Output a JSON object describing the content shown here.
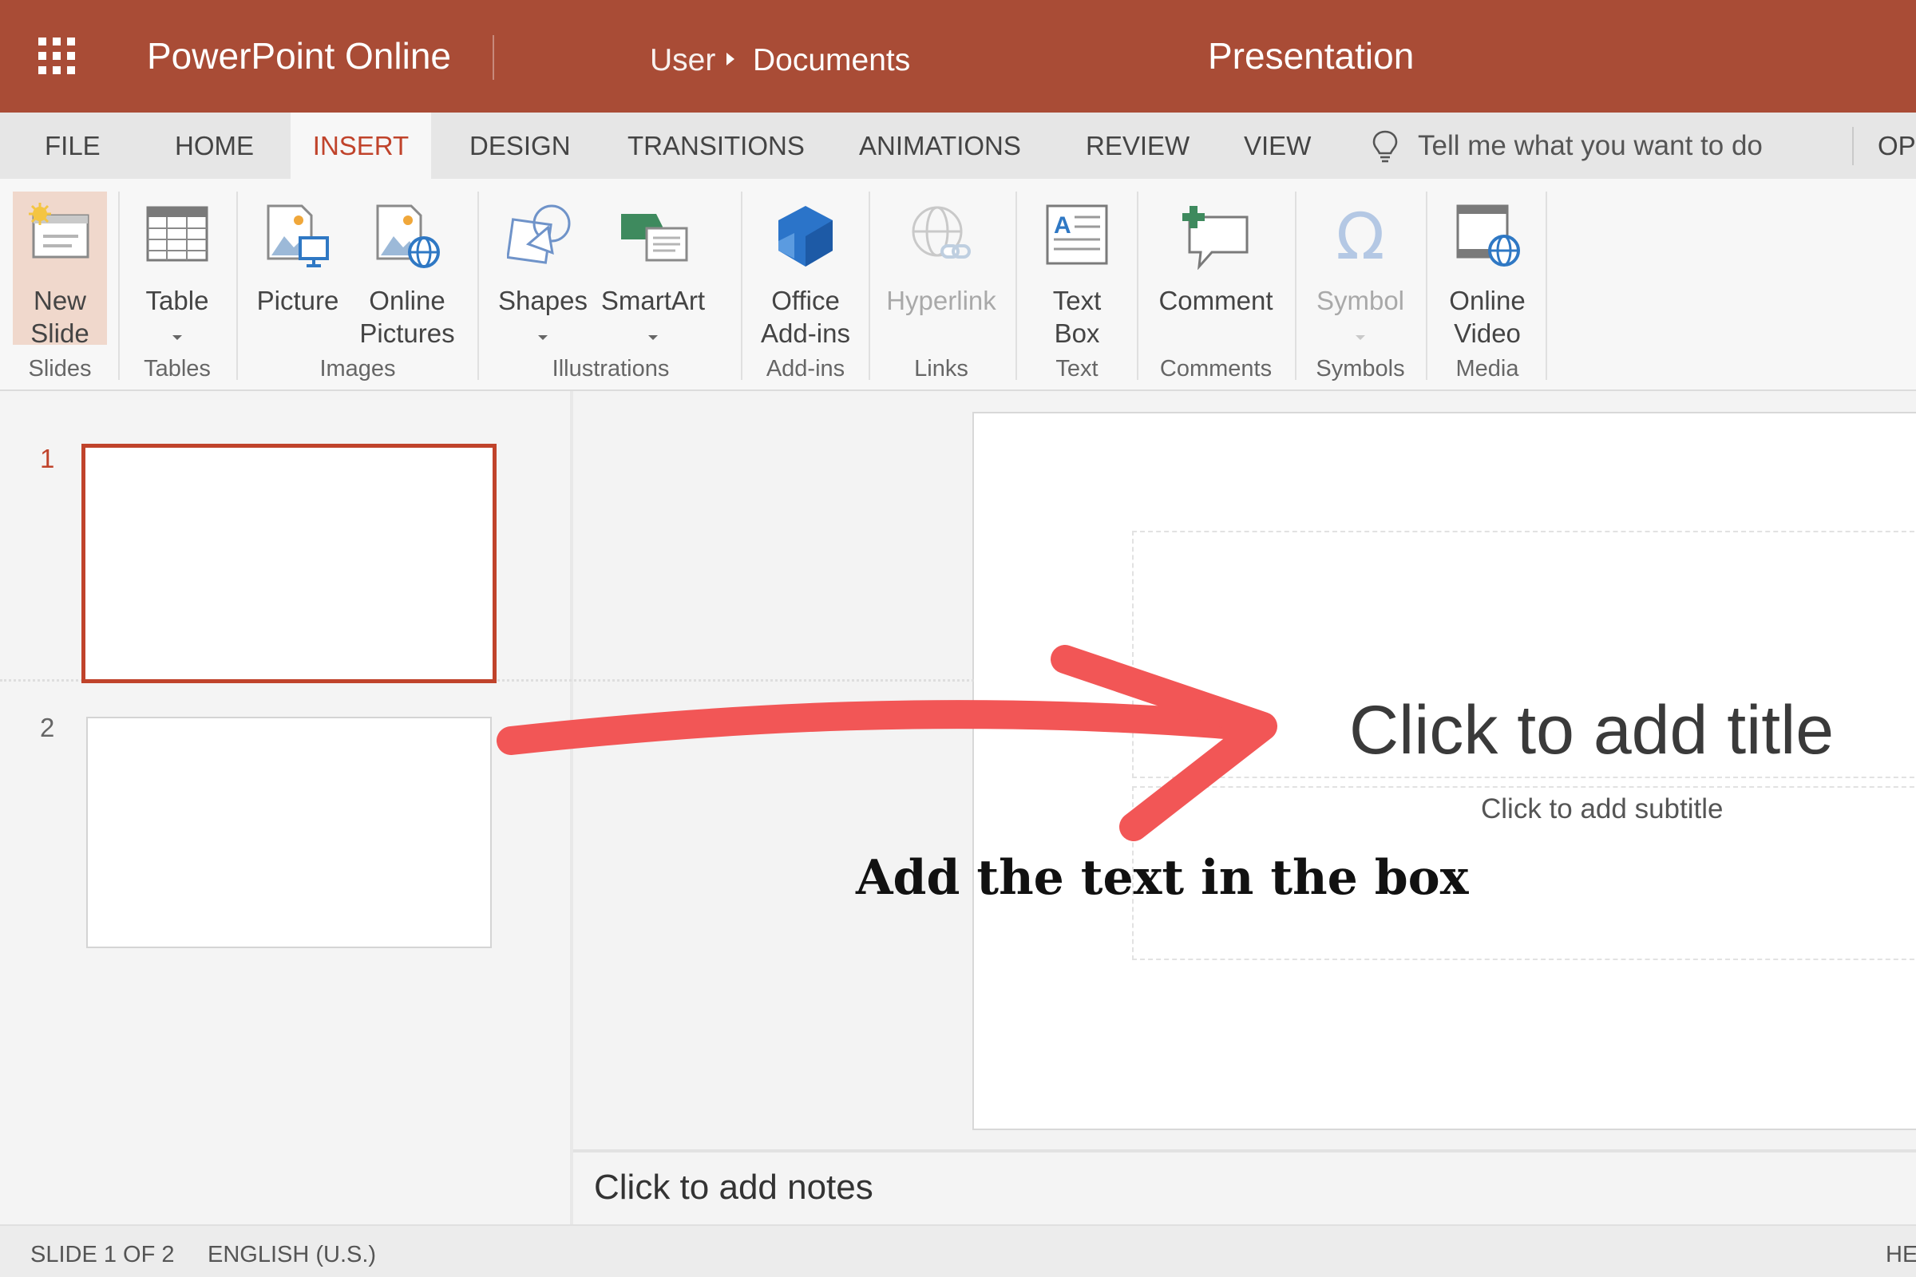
{
  "titlebar": {
    "app_name": "PowerPoint Online",
    "breadcrumb_user": "User",
    "breadcrumb_docs": "Documents",
    "document_title": "Presentation",
    "bg_color": "#a94c36"
  },
  "tabs": {
    "file": "FILE",
    "home": "HOME",
    "insert": "INSERT",
    "design": "DESIGN",
    "transitions": "TRANSITIONS",
    "animations": "ANIMATIONS",
    "review": "REVIEW",
    "view": "VIEW",
    "tell_me": "Tell me what you want to do",
    "overflow": "OP",
    "active_color": "#c0432b"
  },
  "ribbon": {
    "new_slide": "New\nSlide",
    "table": "Table",
    "picture": "Picture",
    "online_pictures": "Online\nPictures",
    "shapes": "Shapes",
    "smartart": "SmartArt",
    "office_addins": "Office\nAdd-ins",
    "hyperlink": "Hyperlink",
    "text_box": "Text\nBox",
    "comment": "Comment",
    "symbol": "Symbol",
    "online_video": "Online\nVideo",
    "groups": {
      "slides": "Slides",
      "tables": "Tables",
      "images": "Images",
      "illustrations": "Illustrations",
      "addins": "Add-ins",
      "links": "Links",
      "text": "Text",
      "comments": "Comments",
      "symbols": "Symbols",
      "media": "Media"
    }
  },
  "slides_panel": {
    "slide1_number": "1",
    "slide2_number": "2"
  },
  "canvas": {
    "title_placeholder": "Click to add title",
    "subtitle_placeholder": "Click to add subtitle",
    "notes_placeholder": "Click to add notes"
  },
  "status": {
    "slide_count": "SLIDE 1 OF 2",
    "language": "ENGLISH (U.S.)",
    "right_overflow": "HE"
  },
  "annotation": {
    "text": "Add the text in the box",
    "arrow_color": "#f25656"
  }
}
